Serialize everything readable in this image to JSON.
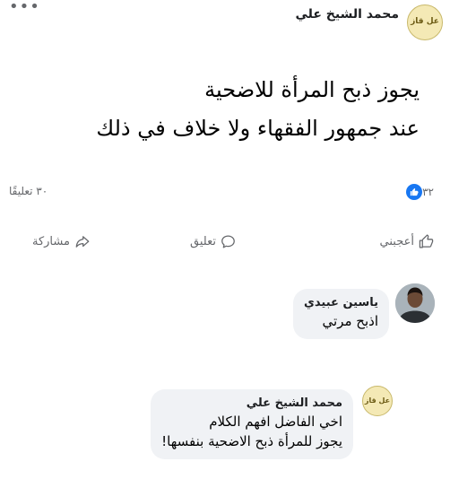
{
  "post": {
    "author_name": "محمد الشيخ علي",
    "avatar_text": "عل قاز",
    "text_lines": [
      "يجوز ذبح المرأة للاضحية",
      "عند جمهور الفقهاء ولا خلاف في ذلك"
    ],
    "reactions_count": "٣٢",
    "comments_count": "٣٠ تعليقًا"
  },
  "actions": {
    "like_label": "أعجبني",
    "comment_label": "تعليق",
    "share_label": "مشاركة"
  },
  "comments": [
    {
      "author": "ياسين عبيدي",
      "lines": [
        "اذبح مرتي"
      ]
    },
    {
      "author": "محمد الشيخ علي",
      "lines": [
        "اخي الفاضل افهم الكلام",
        "يجوز للمرأة ذبح الاضحية بنفسها!"
      ],
      "avatar_text": "عل قاز"
    }
  ],
  "colors": {
    "like_blue": "#1877f2",
    "muted_text": "#65676b",
    "bubble_bg": "#f0f2f5"
  }
}
